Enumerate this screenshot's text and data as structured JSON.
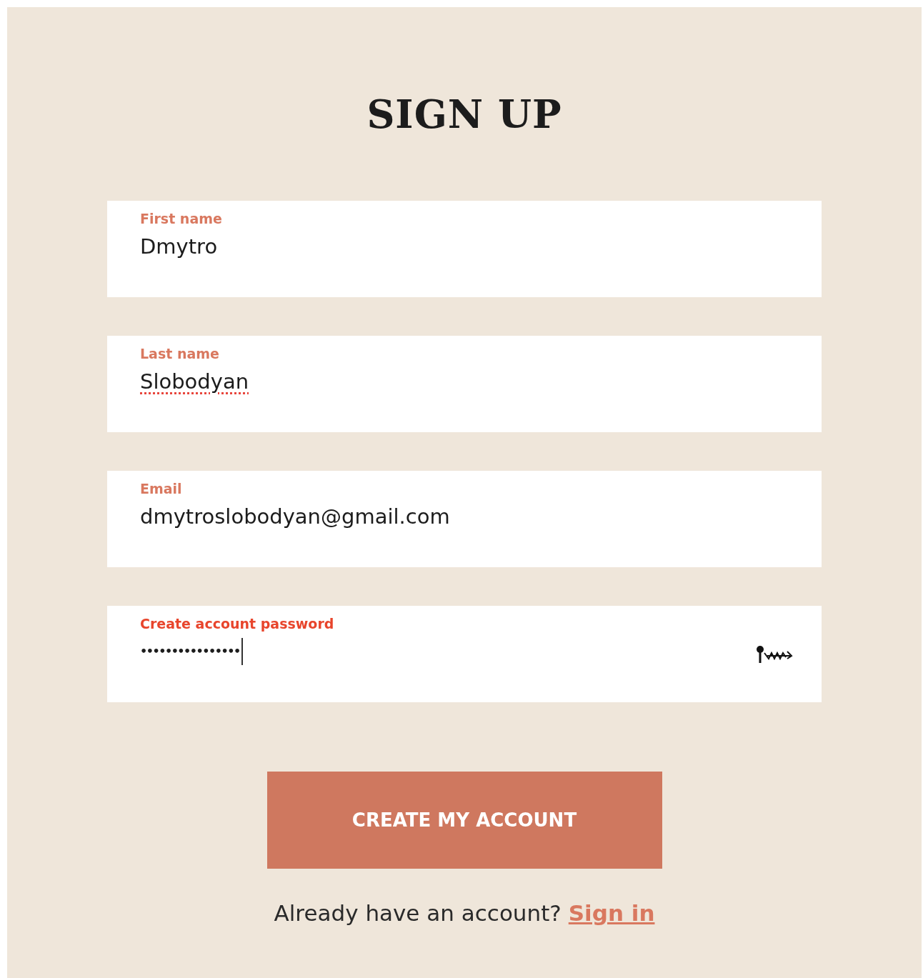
{
  "title": "SIGN UP",
  "fields": [
    {
      "label": "First name",
      "value": "Dmytro",
      "kind": "text",
      "focused": false,
      "misspelled": false
    },
    {
      "label": "Last name",
      "value": "Slobodyan",
      "kind": "text",
      "focused": false,
      "misspelled": true
    },
    {
      "label": "Email",
      "value": "dmytroslobodyan@gmail.com",
      "kind": "text",
      "focused": false,
      "misspelled": false
    },
    {
      "label": "Create account password",
      "value": "••••••••••••••••",
      "kind": "password",
      "focused": true,
      "misspelled": false
    }
  ],
  "submit": "CREATE MY ACCOUNT",
  "footer": {
    "text": "Already have an account?",
    "link": "Sign in"
  }
}
